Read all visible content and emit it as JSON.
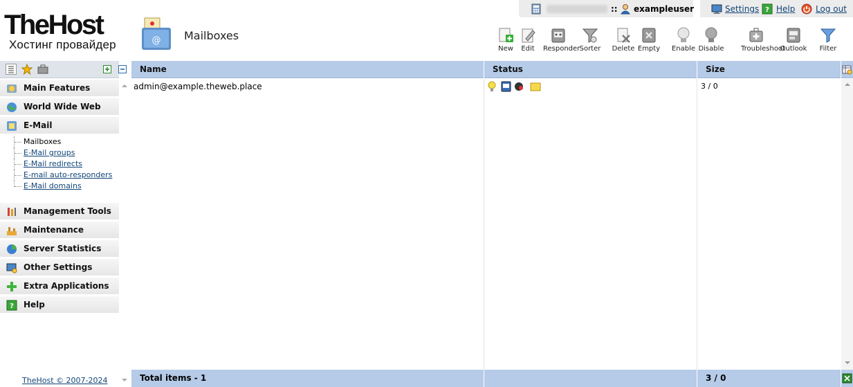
{
  "logo": {
    "line1": "TheHost",
    "line2": "Хостинг провайдер"
  },
  "page": {
    "title": "Mailboxes"
  },
  "userbar": {
    "separator": "::",
    "username": "exampleuser",
    "settings": "Settings",
    "help": "Help",
    "logout": "Log out"
  },
  "toolbar": {
    "new": "New",
    "edit": "Edit",
    "responder": "Responder",
    "sorter": "Sorter",
    "delete": "Delete",
    "empty": "Empty",
    "enable": "Enable",
    "disable": "Disable",
    "troubleshoot": "Troubleshoot",
    "outlook": "Outlook",
    "filter": "Filter"
  },
  "sidebar": {
    "groups": {
      "main_features": "Main Features",
      "www": "World Wide Web",
      "email": "E-Mail",
      "management_tools": "Management Tools",
      "maintenance": "Maintenance",
      "server_statistics": "Server Statistics",
      "other_settings": "Other Settings",
      "extra_applications": "Extra Applications",
      "help": "Help"
    },
    "email_items": {
      "mailboxes": "Mailboxes",
      "groups": "E-Mail groups",
      "redirects": "E-Mail redirects",
      "autoresponders": "E-mail auto-responders",
      "domains": "E-Mail domains"
    },
    "copyright": "TheHost © 2007-2024"
  },
  "table": {
    "columns": {
      "name": "Name",
      "status": "Status",
      "size": "Size"
    },
    "rows": [
      {
        "name": "admin@example.theweb.place",
        "size": "3 / 0"
      }
    ],
    "footer": {
      "total": "Total items - 1",
      "size_total": "3 / 0"
    }
  },
  "colors": {
    "header_blue": "#b5cbe8",
    "link": "#114477",
    "userbar_bg": "#ececec"
  }
}
